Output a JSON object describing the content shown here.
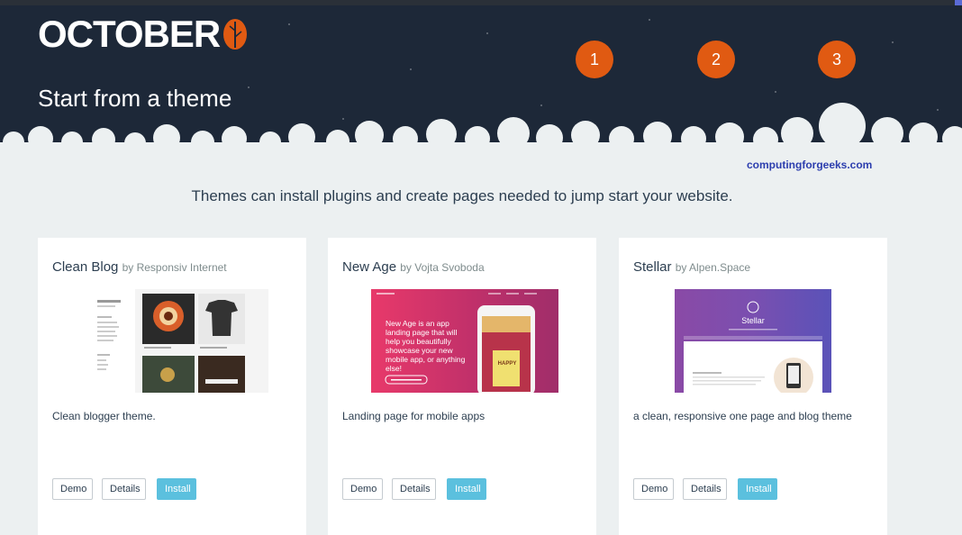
{
  "brand": {
    "logo_text": "OCTOBER",
    "logo_icon": "leaf-icon",
    "accent_color": "#e05a12"
  },
  "header": {
    "title": "Start from a theme",
    "steps": [
      "1",
      "2",
      "3"
    ]
  },
  "watermark": "computingforgeeks.com",
  "subtitle": "Themes can install plugins and create pages needed to jump start your website.",
  "themes": [
    {
      "name": "Clean Blog",
      "author": "by Responsiv Internet",
      "description": "Clean blogger theme.",
      "buttons": {
        "demo": "Demo",
        "details": "Details",
        "install": "Install"
      }
    },
    {
      "name": "New Age",
      "author": "by Vojta Svoboda",
      "description": "Landing page for mobile apps",
      "preview_text": "New Age is an app landing page that will help you beautifully showcase your new mobile app, or anything else!",
      "preview_phone_text": "HAPPY",
      "buttons": {
        "demo": "Demo",
        "details": "Details",
        "install": "Install"
      }
    },
    {
      "name": "Stellar",
      "author": "by Alpen.Space",
      "description": "a clean, responsive one page and blog theme",
      "preview_title": "Stellar",
      "buttons": {
        "demo": "Demo",
        "details": "Details",
        "install": "Install"
      }
    }
  ],
  "colors": {
    "header_bg": "#1d2838",
    "page_bg": "#ecf0f1",
    "install_btn": "#5bc0de",
    "step_badge": "#e05a12"
  }
}
